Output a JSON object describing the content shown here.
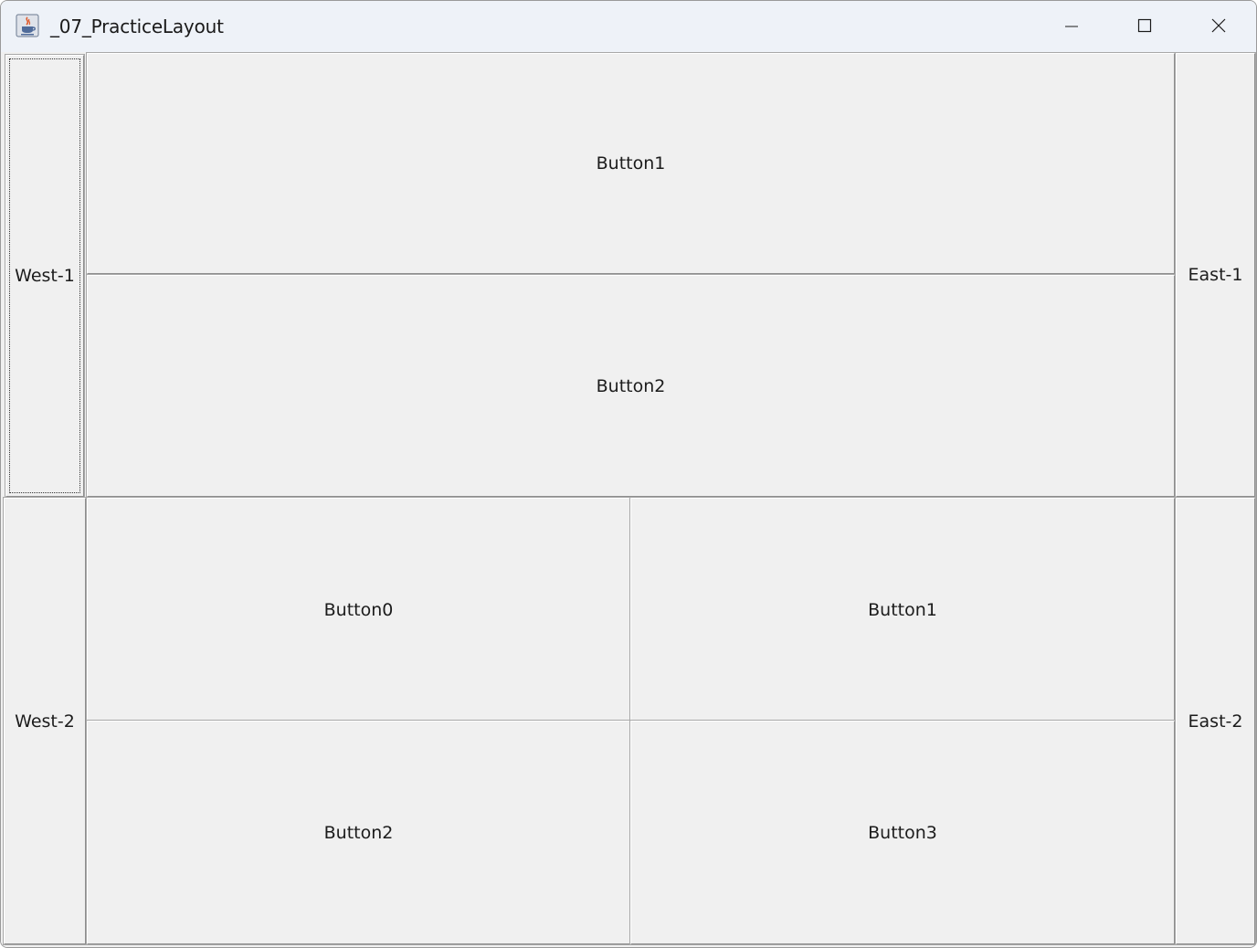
{
  "window": {
    "title": "_07_PracticeLayout",
    "icon": "java-cup-icon",
    "controls": [
      "minimize-icon",
      "maximize-icon",
      "close-icon"
    ]
  },
  "panel1": {
    "west": "West-1",
    "east": "East-1",
    "center": [
      "Button1",
      "Button2"
    ]
  },
  "panel2": {
    "west": "West-2",
    "east": "East-2",
    "center": [
      "Button0",
      "Button1",
      "Button2",
      "Button3"
    ]
  }
}
